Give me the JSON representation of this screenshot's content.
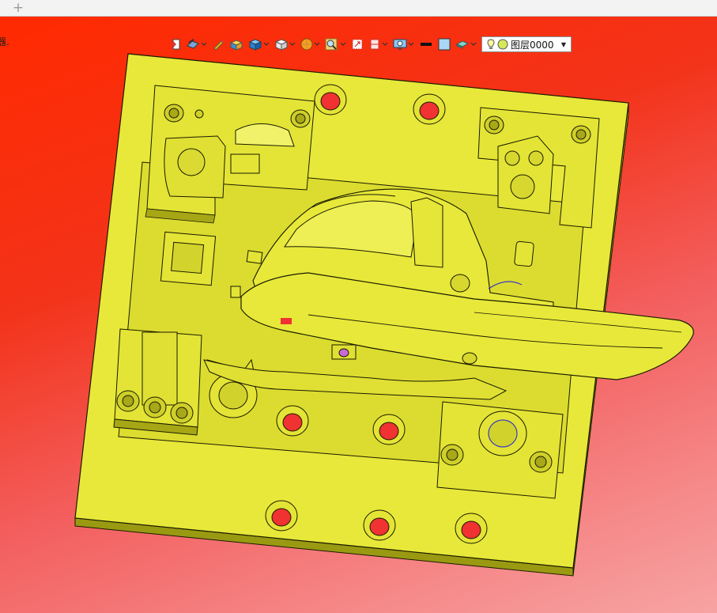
{
  "window": {
    "tab_add_symbol": "+"
  },
  "viewport": {
    "side_text": "器.",
    "background_colors": [
      "#ff2a00",
      "#f3331a",
      "#f36060",
      "#f7a3a3"
    ],
    "model_color": "#e8e83a",
    "pin_hole_color": "#f03232"
  },
  "toolbar": {
    "items": [
      {
        "name": "exit-view-icon"
      },
      {
        "name": "render-style-icon",
        "dropdown": true
      },
      {
        "name": "pencil-icon"
      },
      {
        "name": "shaded-box-icon"
      },
      {
        "name": "view-cube-icon",
        "dropdown": true
      },
      {
        "name": "white-cube-icon",
        "dropdown": true
      },
      {
        "name": "section-sphere-icon",
        "dropdown": true
      },
      {
        "name": "zoom-fit-icon",
        "dropdown": true
      },
      {
        "name": "zoom-window-icon"
      },
      {
        "name": "clip-plane-icon",
        "dropdown": true
      },
      {
        "name": "display-settings-icon",
        "dropdown": true
      },
      {
        "name": "line-color-icon"
      },
      {
        "name": "fill-color-icon"
      },
      {
        "name": "material-icon",
        "dropdown": true
      }
    ],
    "layer": {
      "value": "图层0000"
    }
  }
}
